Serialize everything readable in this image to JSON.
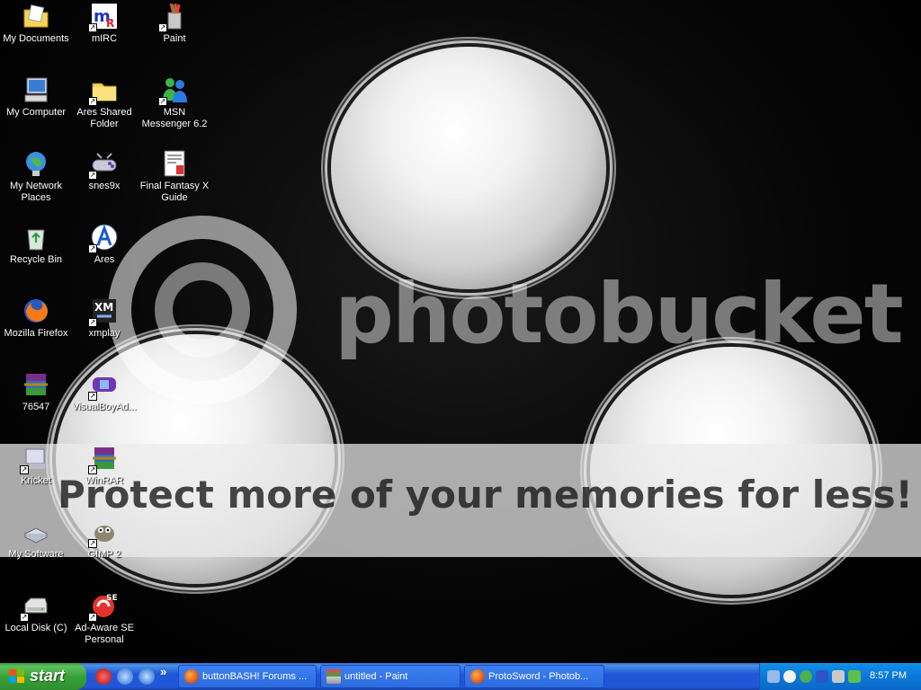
{
  "desktop_icons": [
    {
      "label": "My Documents"
    },
    {
      "label": "mIRC"
    },
    {
      "label": "Paint"
    },
    {
      "label": "My Computer"
    },
    {
      "label": "Ares Shared Folder"
    },
    {
      "label": "MSN Messenger 6.2"
    },
    {
      "label": "My Network Places"
    },
    {
      "label": "snes9x"
    },
    {
      "label": "Final Fantasy X Guide"
    },
    {
      "label": "Recycle Bin"
    },
    {
      "label": "Ares"
    },
    {
      "label": "Mozilla Firefox"
    },
    {
      "label": "xmplay"
    },
    {
      "label": "76547"
    },
    {
      "label": "VisualBoyAd..."
    },
    {
      "label": "Kricket"
    },
    {
      "label": "WinRAR"
    },
    {
      "label": "My Software"
    },
    {
      "label": "GIMP 2"
    },
    {
      "label": "Local Disk (C)"
    },
    {
      "label": "Ad-Aware SE Personal"
    }
  ],
  "watermark": {
    "brand": "photobucket",
    "tagline": "Protect more of your memories for less!"
  },
  "taskbar": {
    "start_label": "start",
    "quick_launch": [
      {
        "icon": "mirc-icon"
      },
      {
        "icon": "msn-icon"
      },
      {
        "icon": "ie-icon"
      }
    ],
    "overflow": "»",
    "buttons": [
      {
        "label": "buttonBASH! Forums ...",
        "icon": "firefox-icon"
      },
      {
        "label": "untitled - Paint",
        "icon": "paint-icon"
      },
      {
        "label": "ProtoSword - Photob...",
        "icon": "firefox-icon"
      }
    ],
    "clock": "8:57 PM"
  }
}
